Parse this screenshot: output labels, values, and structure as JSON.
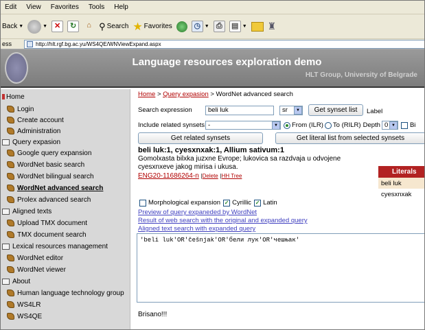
{
  "menubar": [
    "Edit",
    "View",
    "Favorites",
    "Tools",
    "Help"
  ],
  "toolbar": {
    "back_label": "Back",
    "search_label": "Search",
    "favorites_label": "Favorites"
  },
  "address": {
    "label": "ess",
    "url": "http://hlt.rgf.bg.ac.yu/WS4QE/WNViewExpand.aspx"
  },
  "banner": {
    "title": "Language resources exploration demo",
    "subtitle": "HLT Group, University of Belgrade"
  },
  "sidebar": [
    {
      "label": "Home",
      "icon": "home-marker-icon"
    },
    {
      "label": "Login",
      "icon": "leaf-icon"
    },
    {
      "label": "Create account",
      "icon": "leaf-icon"
    },
    {
      "label": "Administration",
      "icon": "leaf-icon"
    },
    {
      "label": "Query expasion",
      "icon": "folder-icon"
    },
    {
      "label": "Google query expansion",
      "icon": "leaf-icon"
    },
    {
      "label": "WordNet basic search",
      "icon": "leaf-icon"
    },
    {
      "label": "WordNet bilingual search",
      "icon": "leaf-icon"
    },
    {
      "label": "WordNet advanced search",
      "icon": "leaf-icon",
      "selected": true
    },
    {
      "label": "Prolex advanced search",
      "icon": "leaf-icon"
    },
    {
      "label": "Aligned texts",
      "icon": "folder-icon"
    },
    {
      "label": "Upload TMX document",
      "icon": "leaf-icon"
    },
    {
      "label": "TMX document search",
      "icon": "leaf-icon"
    },
    {
      "label": "Lexical resources management",
      "icon": "folder-icon"
    },
    {
      "label": "WordNet editor",
      "icon": "leaf-icon"
    },
    {
      "label": "WordNet viewer",
      "icon": "leaf-icon"
    },
    {
      "label": "About",
      "icon": "folder-icon"
    },
    {
      "label": "Human language technology group",
      "icon": "leaf-icon"
    },
    {
      "label": "WS4LR",
      "icon": "leaf-icon"
    },
    {
      "label": "WS4QE",
      "icon": "leaf-icon"
    }
  ],
  "breadcrumb": {
    "home": "Home",
    "sep1": ">",
    "query": "Query expasion",
    "sep2": "> WordNet advanced search"
  },
  "search": {
    "label": "Search expression",
    "value": "beli luk",
    "lang": "sr",
    "get_synset_button": "Get synset list",
    "label_text": "Label",
    "related_label": "Include related synsets",
    "related_value": "-",
    "from_label": "From (ILR)",
    "to_label": "To (RILR)",
    "depth_label": "Depth",
    "depth_value": "0",
    "bi_label": "Bi",
    "get_related_button": "Get related synsets",
    "get_literal_button": "Get literal list from selected synsets"
  },
  "synset": {
    "heading": "beli luk:1, cyesxnxak:1, Allium sativum:1",
    "definition": "Gomolxasta bilxka juzxne Evrope; lukovica sa razdvaja u odvojene cyesxnxeve jakog mirisa i ukusa.",
    "id_link": "ENG20-11686264-n",
    "delete_link": "Delete",
    "tree_link": "HH Tree"
  },
  "literals": {
    "header": "Literals",
    "items": [
      "beli luk",
      "cyesxnxak"
    ]
  },
  "options": {
    "morph": "Morphological expansion",
    "cyrillic": "Cyrillic",
    "latin": "Latin"
  },
  "links": [
    "Preview of query expaneded by WordNet",
    "Result of web search with the original and expanded query",
    "Aligned text search with expanded query"
  ],
  "query_text": "'beli luk'OR'češnjak'OR'бели лук'OR'чешњак'",
  "status": "Brisano!!!"
}
